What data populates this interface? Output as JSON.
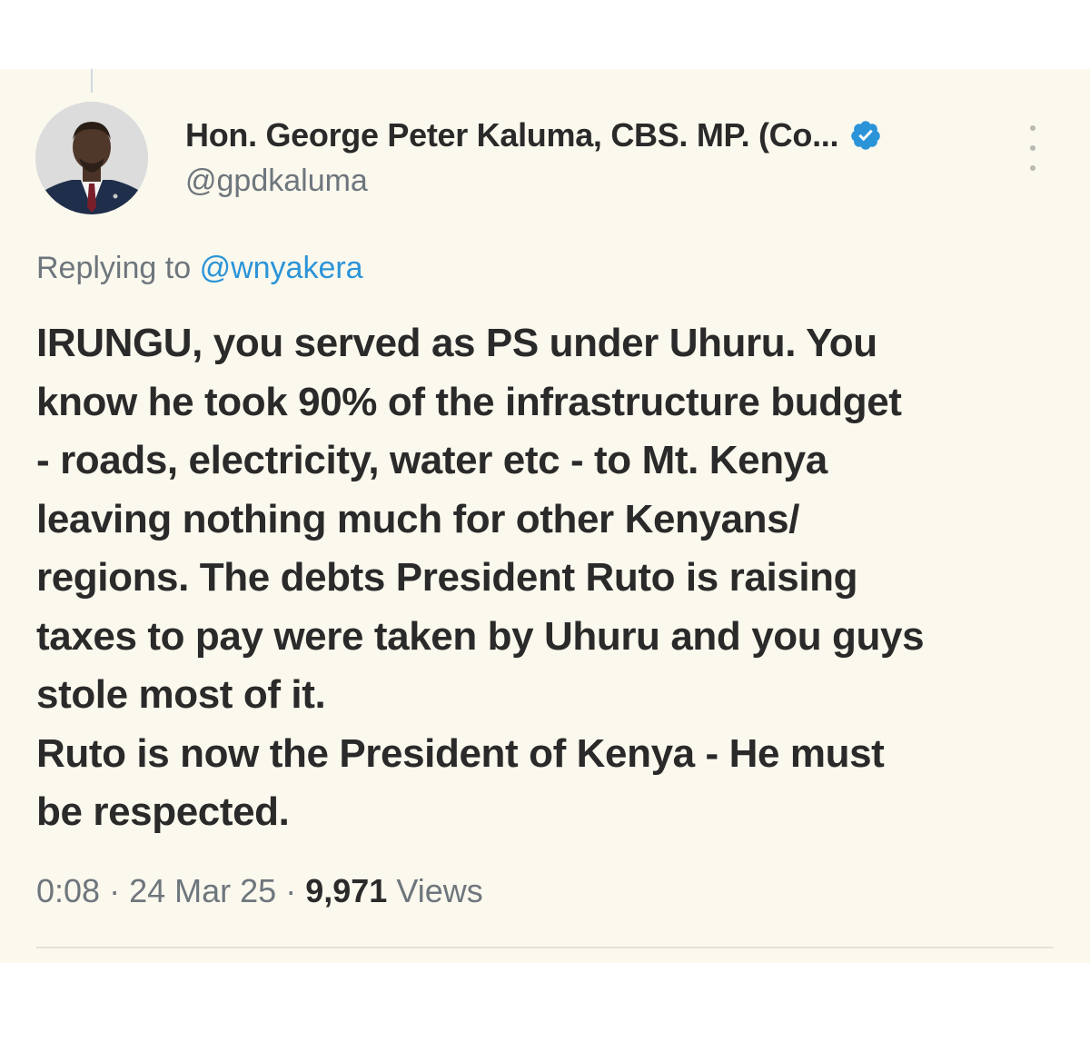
{
  "tweet": {
    "author": {
      "display_name": "Hon. George Peter Kaluma, CBS. MP. (Co...",
      "handle": "@gpdkaluma",
      "verified": true,
      "avatar_icon": "profile-photo-man-in-suit"
    },
    "replying_prefix": "Replying to",
    "replying_to": "@wnyakera",
    "body_lines": [
      "IRUNGU, you served as PS under Uhuru. You",
      "know he took 90% of the infrastructure budget",
      "- roads, electricity, water etc - to Mt. Kenya",
      "leaving nothing much for other Kenyans/",
      "regions. The debts President Ruto is raising",
      "taxes to pay were taken by Uhuru and you guys",
      "stole most of it.",
      "Ruto is now the President of Kenya - He must",
      "be respected."
    ],
    "time": "0:08",
    "separator": "·",
    "date": "24 Mar 25",
    "views_count": "9,971",
    "views_label": "Views"
  },
  "colors": {
    "card_background": "#fbf8ed",
    "primary_text": "#2a2a2a",
    "secondary_text": "#6e767d",
    "link": "#2b94d8",
    "verified_badge": "#2b94d8"
  }
}
